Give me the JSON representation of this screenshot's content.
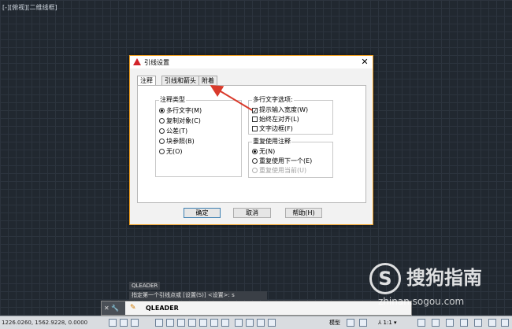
{
  "viewport": {
    "label": "[-][俯视][二维线框]"
  },
  "dialog": {
    "title": "引线设置",
    "close_glyph": "✕",
    "tabs": [
      {
        "label": "注释",
        "active": true
      },
      {
        "label": "引线和箭头",
        "active": false
      },
      {
        "label": "附着",
        "active": false
      }
    ],
    "annotation_type": {
      "title": "注释类型",
      "options": [
        {
          "label": "多行文字(M)",
          "selected": true
        },
        {
          "label": "复制对象(C)",
          "selected": false
        },
        {
          "label": "公差(T)",
          "selected": false
        },
        {
          "label": "块参照(B)",
          "selected": false
        },
        {
          "label": "无(O)",
          "selected": false
        }
      ]
    },
    "mtext_options": {
      "title": "多行文字选项:",
      "options": [
        {
          "label": "提示输入宽度(W)",
          "checked": true
        },
        {
          "label": "始终左对齐(L)",
          "checked": false
        },
        {
          "label": "文字边框(F)",
          "checked": false
        }
      ]
    },
    "reuse": {
      "title": "重复使用注释",
      "options": [
        {
          "label": "无(N)",
          "selected": true,
          "disabled": false
        },
        {
          "label": "重复使用下一个(E)",
          "selected": false,
          "disabled": false
        },
        {
          "label": "重复使用当前(U)",
          "selected": false,
          "disabled": true
        }
      ]
    },
    "buttons": {
      "ok": "确定",
      "cancel": "取消",
      "help": "帮助(H)"
    }
  },
  "command": {
    "history": "QLEADER",
    "prompt": "指定第一个引线点或 [设置(S)] <设置>: s",
    "side_glyphs": "✕ 🔧",
    "input": "QLEADER",
    "icon": "✎"
  },
  "statusbar": {
    "coords": "1226.0260, 1562.9228, 0.0000",
    "model_tab": "模型",
    "scale": "⅄ 1:1 ▾"
  },
  "watermark": {
    "text": "搜狗指南",
    "url": "zhinan.sogou.com",
    "logo_letter": "S"
  },
  "colors": {
    "accent_border": "#f0a020",
    "arrow": "#d93a2b",
    "canvas": "#212830"
  }
}
